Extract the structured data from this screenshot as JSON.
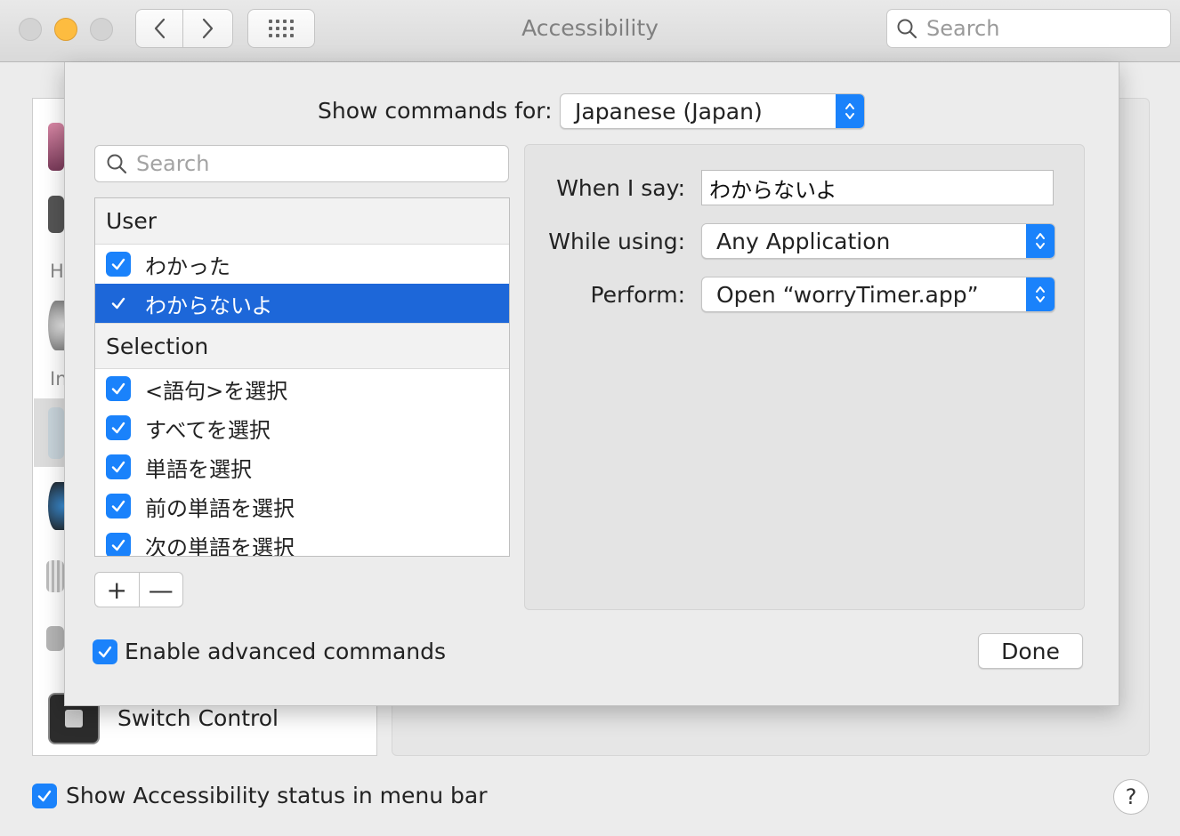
{
  "window": {
    "title": "Accessibility",
    "search_placeholder": "Search"
  },
  "background": {
    "sidebar_partial_letters": [
      "H",
      "In"
    ],
    "sidebar_visible_item": "Switch Control",
    "status_checkbox_label": "Show Accessibility status in menu bar",
    "status_checkbox_checked": true,
    "help_label": "?"
  },
  "sheet": {
    "show_commands_label": "Show commands for:",
    "language_value": "Japanese (Japan)",
    "search_placeholder": "Search",
    "groups": [
      {
        "title": "User",
        "items": [
          {
            "label": "わかった",
            "checked": true,
            "selected": false
          },
          {
            "label": "わからないよ",
            "checked": true,
            "selected": true
          }
        ]
      },
      {
        "title": "Selection",
        "items": [
          {
            "label": "<語句>を選択",
            "checked": true,
            "selected": false
          },
          {
            "label": "すべてを選択",
            "checked": true,
            "selected": false
          },
          {
            "label": "単語を選択",
            "checked": true,
            "selected": false
          },
          {
            "label": "前の単語を選択",
            "checked": true,
            "selected": false
          },
          {
            "label": "次の単語を選択",
            "checked": true,
            "selected": false
          }
        ]
      }
    ],
    "add_label": "+",
    "remove_label": "—",
    "detail": {
      "when_label": "When I say:",
      "when_value": "わからないよ",
      "using_label": "While using:",
      "using_value": "Any Application",
      "perform_label": "Perform:",
      "perform_value": "Open “worryTimer.app”"
    },
    "advanced_label": "Enable advanced commands",
    "advanced_checked": true,
    "done_label": "Done"
  },
  "colors": {
    "accent": "#1a82fb",
    "selection": "#1d67d9"
  }
}
